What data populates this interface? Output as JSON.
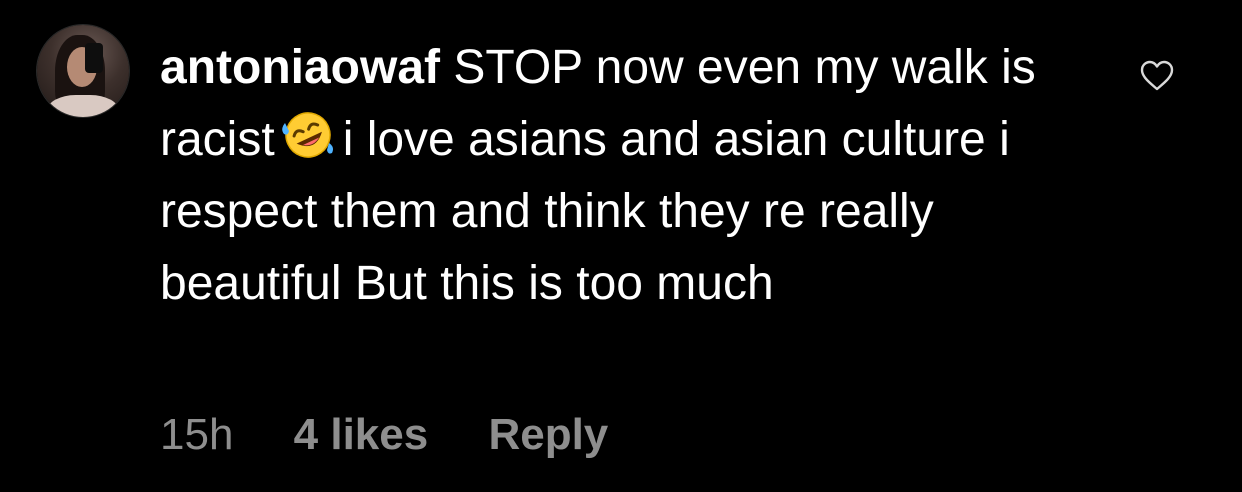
{
  "comment": {
    "username": "antoniaowaf",
    "text_part1": "STOP now even my walk is racist",
    "emoji_icon": "rolling-on-the-floor-laughing-emoji",
    "text_part2": "i love asians and asian culture i respect them and think they re really beautiful But this is too much",
    "timestamp": "15h",
    "likes": "4 likes",
    "reply_label": "Reply",
    "like_icon": "heart-outline-icon"
  },
  "colors": {
    "background": "#000000",
    "text": "#ffffff",
    "meta": "#8e8e8e"
  }
}
